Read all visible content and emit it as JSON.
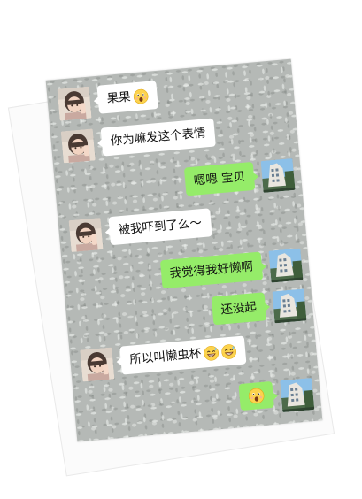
{
  "chat": {
    "messages": [
      {
        "side": "left",
        "text": "果果",
        "emoji": "astonished-face"
      },
      {
        "side": "left",
        "text": "你为嘛发这个表情"
      },
      {
        "side": "right",
        "text": "嗯嗯 宝贝"
      },
      {
        "side": "left",
        "text": "被我吓到了么～"
      },
      {
        "side": "right",
        "text": "我觉得我好懒啊"
      },
      {
        "side": "right",
        "text": "还没起"
      },
      {
        "side": "left",
        "text": "所以叫懒虫杯",
        "emoji": "grinning-sweat-face"
      },
      {
        "side": "right",
        "text": "",
        "emoji": "astonished-face"
      }
    ]
  },
  "colors": {
    "sent_bubble": "#95ec69",
    "received_bubble": "#ffffff",
    "chat_background": "#b5b9b6"
  }
}
